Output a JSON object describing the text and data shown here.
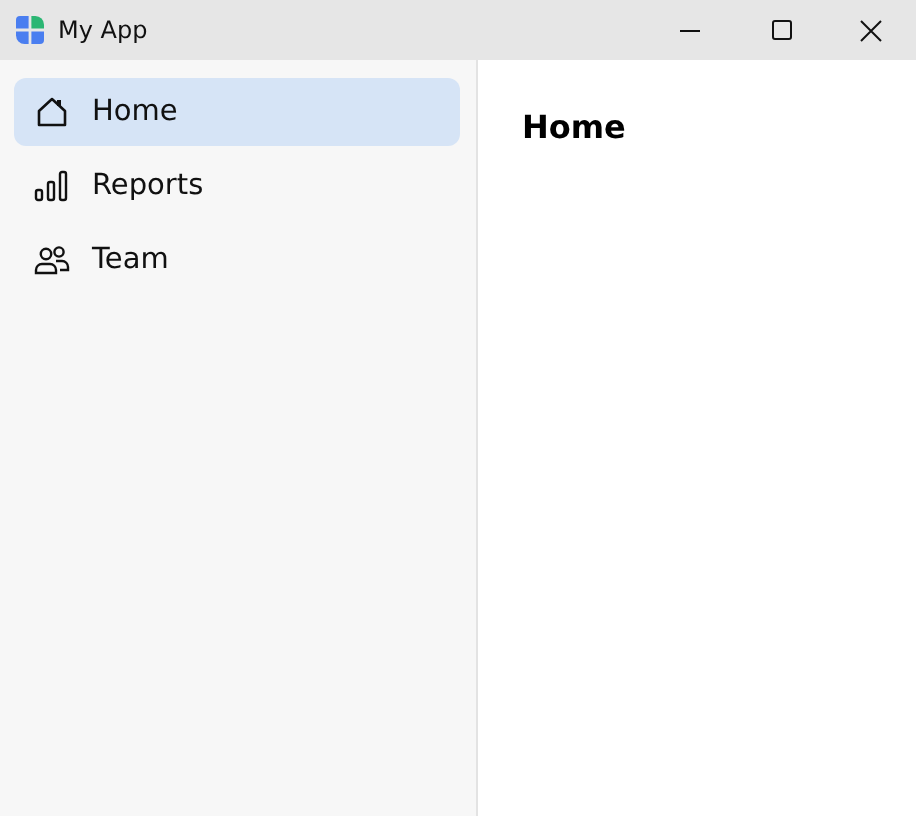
{
  "window": {
    "title": "My App"
  },
  "sidebar": {
    "items": [
      {
        "label": "Home",
        "selected": true
      },
      {
        "label": "Reports",
        "selected": false
      },
      {
        "label": "Team",
        "selected": false
      }
    ]
  },
  "content": {
    "heading": "Home"
  }
}
